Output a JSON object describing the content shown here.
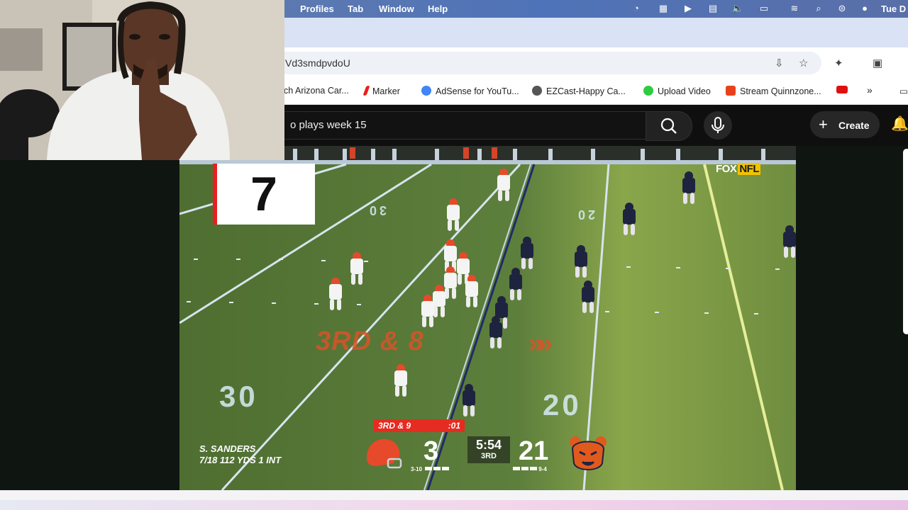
{
  "menubar": {
    "items": [
      "Profiles",
      "Tab",
      "Window",
      "Help"
    ],
    "clock": "Tue D"
  },
  "address": {
    "url": "Vd3smdpvdoU"
  },
  "bookmarks": [
    {
      "label": "ch Arizona Car...",
      "color": "#ffffff"
    },
    {
      "label": "Marker",
      "color": "#e8201a"
    },
    {
      "label": "AdSense for YouTu...",
      "color": "#4285f4"
    },
    {
      "label": "EZCast-Happy Ca...",
      "color": "#444444"
    },
    {
      "label": "Upload Video",
      "color": "#2ecc40"
    },
    {
      "label": "Stream Quinnzone...",
      "color": "#e8401a"
    },
    {
      "label": "",
      "color": "#e01010"
    }
  ],
  "youtube": {
    "search_query": "o plays week 15",
    "create_label": "Create"
  },
  "video": {
    "play_number": "7",
    "network": "FOX",
    "network_sub": "NFL",
    "down_distance_field": "3RD & 8",
    "yard_markers": [
      "30",
      "20",
      "30",
      "20"
    ],
    "scorebug": {
      "down_distance": "3RD & 9",
      "play_clock": ":01",
      "away_score": "3",
      "home_score": "21",
      "game_clock": "5:54",
      "quarter": "3RD",
      "away_record": "3-10",
      "home_record": "9-4"
    },
    "passer": {
      "name": "S. SANDERS",
      "line": "7/18  112 YDS  1 INT"
    }
  },
  "colors": {
    "browns_orange": "#e64a2a",
    "bears_navy": "#1e2340",
    "bears_orange": "#e05a1e",
    "field_green": "#5a7a3a",
    "scorebug_red": "#e62b20"
  }
}
